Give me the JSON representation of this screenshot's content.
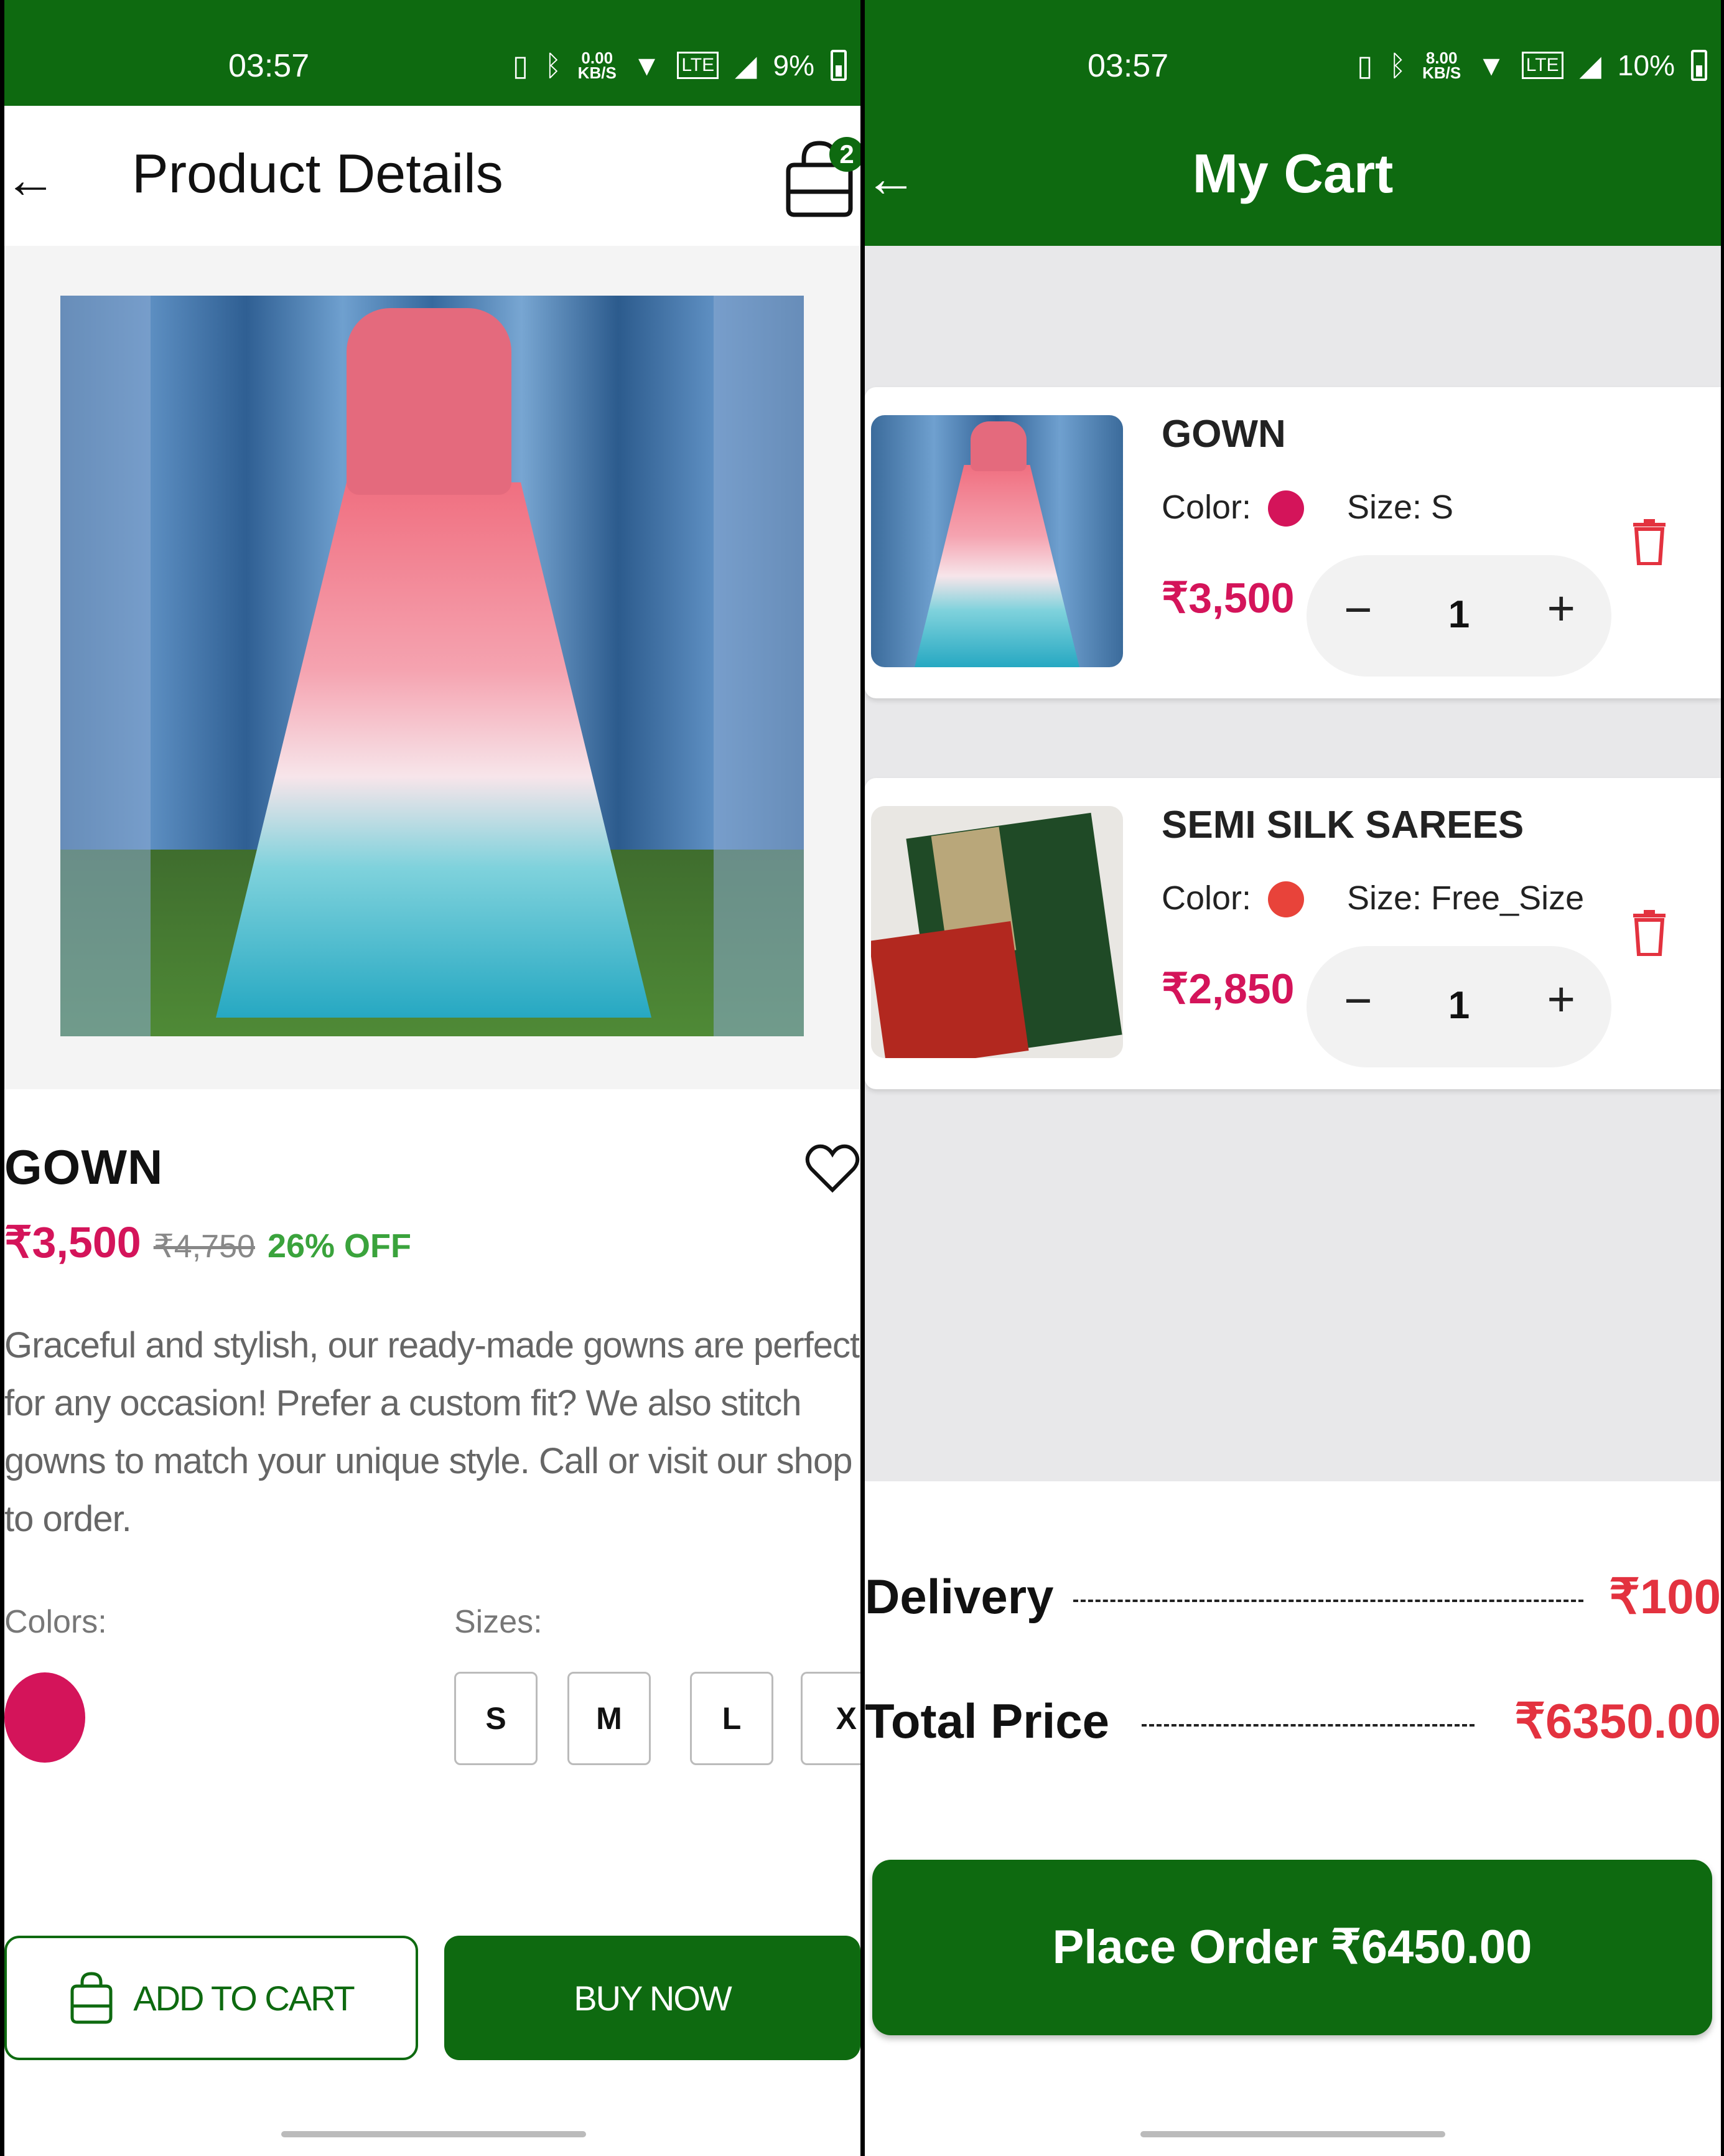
{
  "left": {
    "status": {
      "time": "03:57",
      "net_speed": "0.00\nKB/S",
      "battery": "9%"
    },
    "appbar": {
      "back_glyph": "←",
      "title": "Product Details",
      "cart_badge": "2"
    },
    "product": {
      "name": "GOWN",
      "price": "₹3,500",
      "mrp": "₹4,750",
      "discount": "26% OFF",
      "description": "Graceful and stylish, our ready-made gowns are perfect for any occasion! Prefer a custom fit? We also stitch gowns to match your unique style. Call or visit our shop to order.",
      "colors_label": "Colors:",
      "sizes_label": "Sizes:",
      "color_swatch": "#d4145a",
      "sizes": [
        "S",
        "M",
        "L",
        "X"
      ]
    },
    "buttons": {
      "add_to_cart": "ADD TO CART",
      "buy_now": "BUY NOW"
    }
  },
  "right": {
    "status": {
      "time": "03:57",
      "net_speed": "8.00\nKB/S",
      "battery": "10%"
    },
    "appbar": {
      "back_glyph": "←",
      "title": "My Cart"
    },
    "items": [
      {
        "name": "GOWN",
        "color_label": "Color:",
        "color": "#d4145a",
        "size": "Size: S",
        "price": "₹3,500",
        "qty": "1"
      },
      {
        "name": "SEMI SILK SAREES",
        "color_label": "Color:",
        "color": "#e8433a",
        "size": "Size: Free_Size",
        "price": "₹2,850",
        "qty": "1"
      }
    ],
    "summary": {
      "delivery_label": "Delivery",
      "delivery_value": "₹100",
      "total_label": "Total Price",
      "total_value": "₹6350.00"
    },
    "place_order": "Place Order ₹6450.00"
  },
  "colors": {
    "brand_green": "#0e6a10",
    "price_pink": "#d4145a",
    "discount_green": "#3aa33c",
    "summary_red": "#e3323f"
  }
}
